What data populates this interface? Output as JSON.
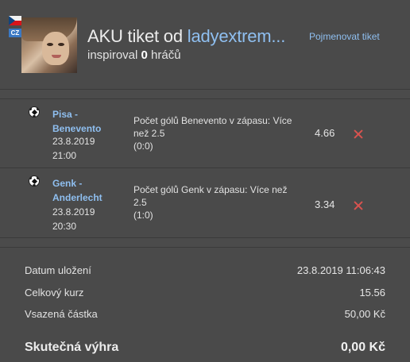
{
  "header": {
    "title_prefix": "AKU tiket od ",
    "username": "ladyextrem...",
    "inspired_prefix": "inspiroval ",
    "inspired_count": "0",
    "inspired_suffix": " hráčů",
    "rename_label": "Pojmenovat tiket",
    "country_code": "CZ"
  },
  "bets": [
    {
      "match": "Pisa - Benevento",
      "date": "23.8.2019",
      "time": "21:00",
      "description": "Počet gólů Benevento v zápasu: Více než 2.5",
      "score": "(0:0)",
      "odds": "4.66",
      "status": "lost"
    },
    {
      "match": "Genk - Anderlecht",
      "date": "23.8.2019",
      "time": "20:30",
      "description": "Počet gólů Genk v zápasu: Více než 2.5",
      "score": "(1:0)",
      "odds": "3.34",
      "status": "lost"
    }
  ],
  "summary": {
    "saved_label": "Datum uložení",
    "saved_value": "23.8.2019 11:06:43",
    "total_odds_label": "Celkový kurz",
    "total_odds_value": "15.56",
    "stake_label": "Vsazená částka",
    "stake_value": "50,00 Kč",
    "win_label": "Skutečná výhra",
    "win_value": "0,00 Kč"
  },
  "colors": {
    "background": "#4b4b4b",
    "link": "#8fbff0",
    "lost": "#d9534f"
  }
}
